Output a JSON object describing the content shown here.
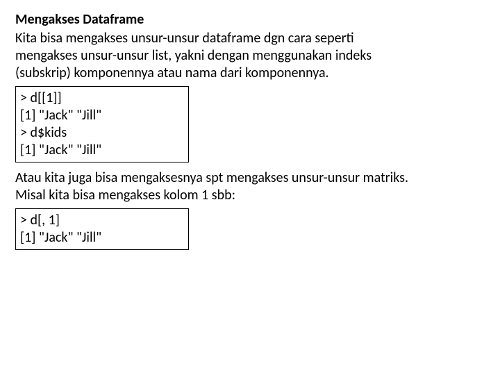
{
  "title": "Mengakses Dataframe",
  "para1_line1": "Kita bisa mengakses unsur-unsur dataframe dgn cara seperti",
  "para1_line2": "mengakses unsur-unsur list, yakni dengan menggunakan indeks",
  "para1_line3": "(subskrip) komponennya atau nama dari komponennya.",
  "code1": {
    "l1": "> d[[1]]",
    "l2": "[1] \"Jack\" \"Jill\"",
    "l3": "> d$kids",
    "l4": "[1] \"Jack\" \"Jill\""
  },
  "para2_line1": "Atau kita juga bisa mengaksesnya spt mengakses unsur-unsur matriks.",
  "para2_line2": "Misal kita bisa mengakses kolom 1 sbb:",
  "code2": {
    "l1": "> d[, 1]",
    "l2": "[1] \"Jack\" \"Jill\""
  }
}
